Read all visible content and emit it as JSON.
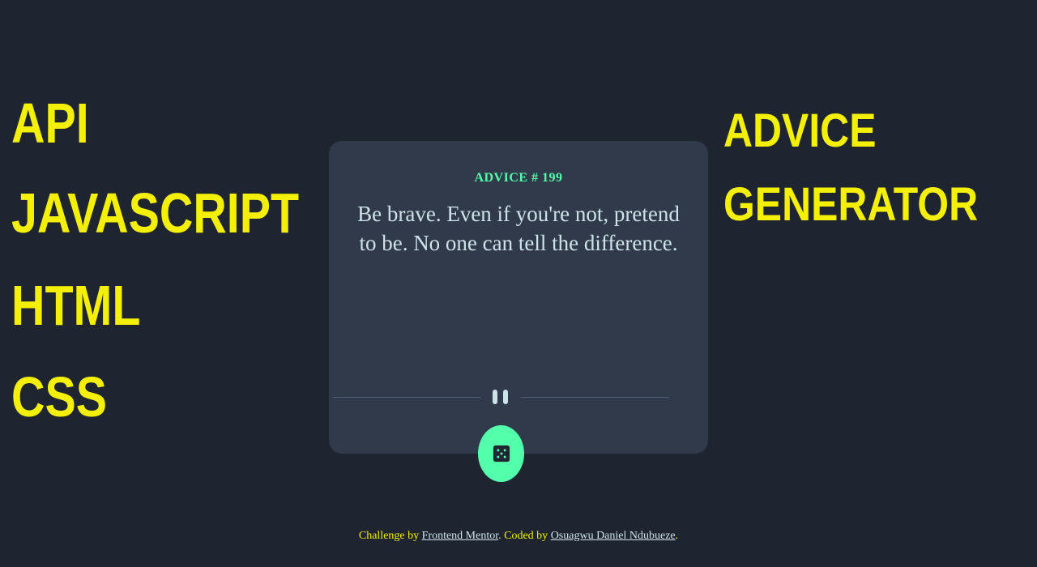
{
  "tech_stack": [
    "API",
    "JAVASCRIPT",
    "HTML",
    "CSS"
  ],
  "headline": {
    "line1": "ADVICE",
    "line2": "GENERATOR"
  },
  "advice": {
    "id_label": "ADVICE # 199",
    "text": "Be brave. Even if you're not, pretend to be. No one can tell the difference."
  },
  "divider": {
    "icon": "pause-icon"
  },
  "dice_button": {
    "icon": "dice-icon"
  },
  "footer": {
    "prefix": "Challenge by ",
    "link1": "Frontend Mentor",
    "middle": ". Coded by ",
    "link2": "Osuagwu Daniel Ndubueze",
    "suffix": "."
  },
  "colors": {
    "background": "#1f2530",
    "card": "#313a4a",
    "accent": "#53ffab",
    "highlight": "#f4f003",
    "text": "#cee3e9"
  }
}
